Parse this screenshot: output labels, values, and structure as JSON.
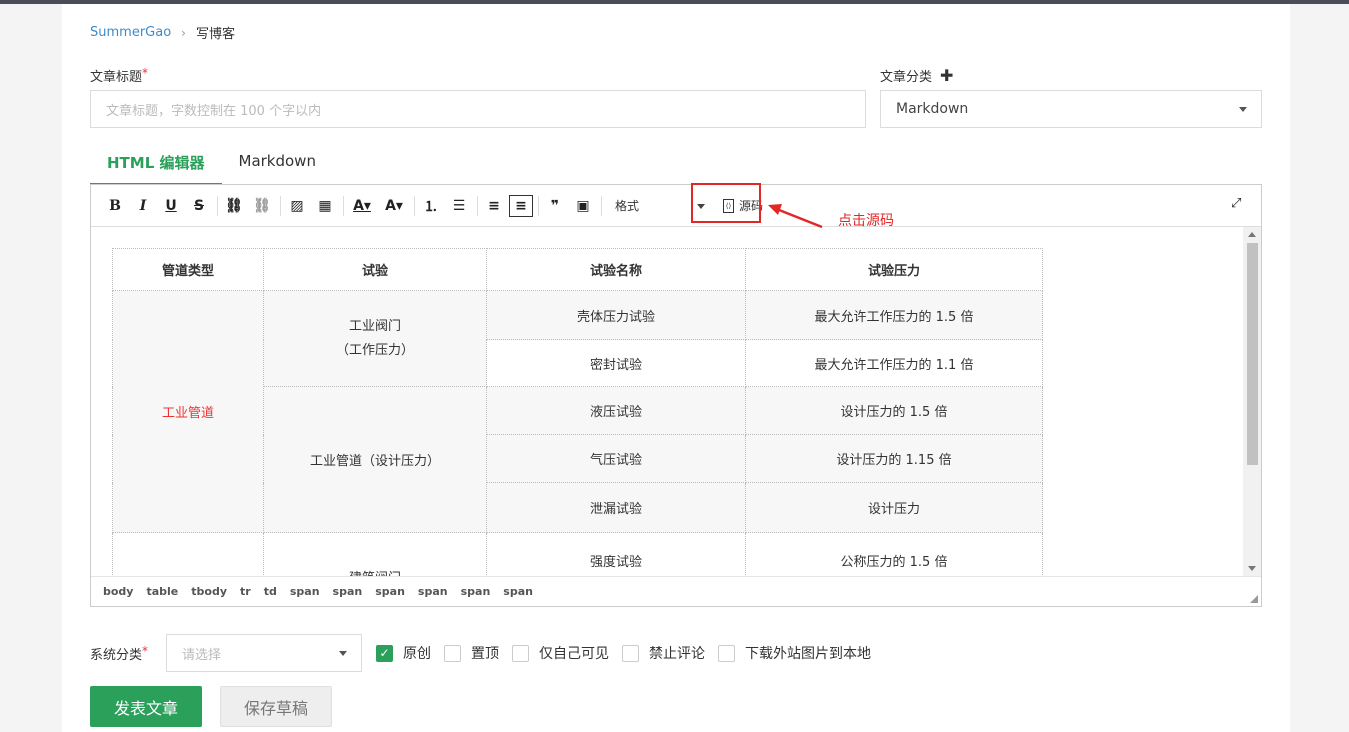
{
  "breadcrumb": {
    "user": "SummerGao",
    "current": "写博客"
  },
  "title_field": {
    "label": "文章标题",
    "required": "*",
    "placeholder": "文章标题，字数控制在 100 个字以内"
  },
  "category_field": {
    "label": "文章分类",
    "add": "✚",
    "value": "Markdown"
  },
  "tabs": [
    {
      "label": "HTML 编辑器"
    },
    {
      "label": "Markdown"
    }
  ],
  "toolbar": {
    "bold": "B",
    "italic": "I",
    "underline": "U",
    "strike": "S",
    "link": "⛓",
    "unlink": "⛓",
    "image": "▨",
    "table": "▦",
    "font_color": "A▾",
    "bg_color": "A▾",
    "ordered_list": "⒈",
    "bullet_list": "☰",
    "align_left": "≡",
    "align_center": "≡",
    "quote": "❞",
    "clear": "▣",
    "format_label": "格式",
    "source_label": "源码",
    "fullscreen": "⤢"
  },
  "annotation": {
    "text": "点击源码"
  },
  "table": {
    "headers": [
      "管道类型",
      "试验",
      "试验名称",
      "试验压力"
    ],
    "group1_type": "工业管道",
    "valve_line1": "工业阀门",
    "valve_line2": "（工作压力）",
    "pipe_label": "工业管道（设计压力）",
    "building_valve": "建筑阀门",
    "rows": [
      {
        "name": "壳体压力试验",
        "pressure": "最大允许工作压力的 1.5 倍"
      },
      {
        "name": "密封试验",
        "pressure": "最大允许工作压力的 1.1 倍"
      },
      {
        "name": "液压试验",
        "pressure": "设计压力的 1.5 倍"
      },
      {
        "name": "气压试验",
        "pressure": "设计压力的 1.15 倍"
      },
      {
        "name": "泄漏试验",
        "pressure": "设计压力"
      },
      {
        "name": "强度试验",
        "pressure": "公称压力的 1.5 倍"
      }
    ]
  },
  "statusbar": [
    "body",
    "table",
    "tbody",
    "tr",
    "td",
    "span",
    "span",
    "span",
    "span",
    "span",
    "span"
  ],
  "system_category": {
    "label": "系统分类",
    "required": "*",
    "placeholder": "请选择"
  },
  "checkboxes": [
    {
      "label": "原创",
      "checked": true
    },
    {
      "label": "置顶",
      "checked": false
    },
    {
      "label": "仅自己可见",
      "checked": false
    },
    {
      "label": "禁止评论",
      "checked": false
    },
    {
      "label": "下载外站图片到本地",
      "checked": false
    }
  ],
  "buttons": {
    "publish": "发表文章",
    "save_draft": "保存草稿"
  },
  "colors": {
    "accent": "#2aa05b",
    "annotation": "#e32727",
    "link": "#3f8ac9"
  }
}
